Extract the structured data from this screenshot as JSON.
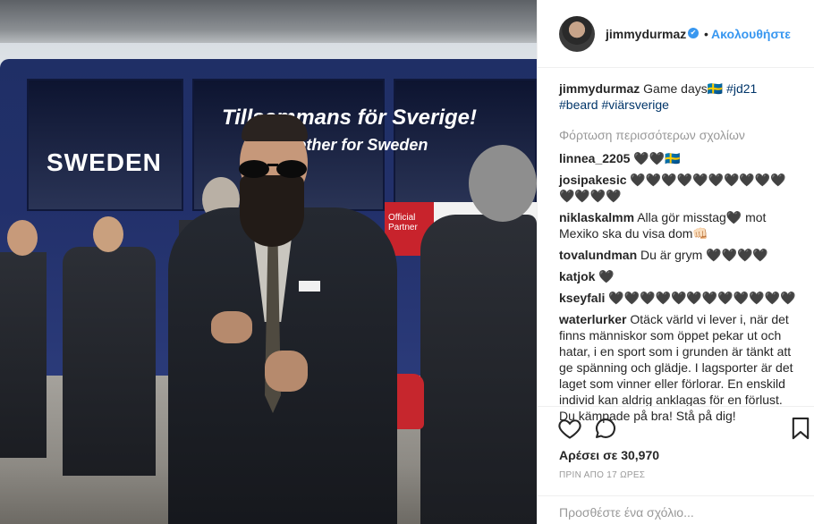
{
  "post": {
    "image_alt": "Bearded man in dark suit and sunglasses buttoning his jacket in front of the Sweden team bus",
    "bus_text_1": "SWEDEN",
    "bus_text_2": "Tillsammans för Sverige!",
    "bus_text_3": "Together for Sweden",
    "bus_text_4": "Official Partner"
  },
  "header": {
    "username": "jimmydurmaz",
    "verified_icon": "verified-badge-icon",
    "separator": "•",
    "follow_label": "Ακολουθήστε"
  },
  "caption": {
    "username": "jimmydurmaz",
    "text": "Game days",
    "flag": "🇸🇪",
    "hashtags": [
      "#jd21",
      "#beard",
      "#viärsverige"
    ]
  },
  "load_more": "Φόρτωση περισσότερων σχολίων",
  "comments": [
    {
      "user": "linnea_2205",
      "text": "🖤🖤🇸🇪"
    },
    {
      "user": "josipakesic",
      "text": "🖤🖤🖤🖤🖤🖤🖤🖤🖤🖤🖤🖤🖤🖤"
    },
    {
      "user": "niklaskalmm",
      "text": "Alla gör misstag🖤 mot Mexiko ska du visa dom👊🏻"
    },
    {
      "user": "tovalundman",
      "text": "Du är grym 🖤🖤🖤🖤"
    },
    {
      "user": "katjok",
      "text": "🖤"
    },
    {
      "user": "kseyfali",
      "text": "🖤🖤🖤🖤🖤🖤🖤🖤🖤🖤🖤🖤"
    },
    {
      "user": "waterlurker",
      "text": "Otäck värld vi lever i, när det finns människor som öppet pekar ut och hatar, i en sport som i grunden är tänkt att ge spänning och glädje. I lagsporter är det laget som vinner eller förlorar. En enskild individ kan aldrig anklagas för en förlust. Du kämpade på bra! Stå på dig!"
    }
  ],
  "actions": {
    "like_icon": "heart-icon",
    "comment_icon": "comment-icon",
    "save_icon": "bookmark-icon",
    "likes_text": "Αρέσει σε 30,970",
    "time_text": "ΠΡΙΝ ΑΠΟ 17 ΩΡΕΣ"
  },
  "add_comment": {
    "placeholder": "Προσθέστε ένα σχόλιο..."
  },
  "colors": {
    "link_blue": "#3897f0",
    "hashtag_blue": "#003569",
    "muted_gray": "#999999",
    "text": "#262626",
    "divider": "#efefef"
  }
}
